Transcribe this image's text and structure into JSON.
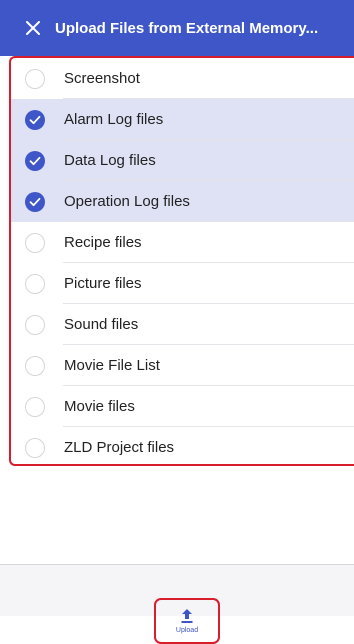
{
  "header": {
    "close_icon": "close-icon",
    "title": "Upload Files from External Memory..."
  },
  "colors": {
    "accent": "#3f56c8",
    "selected_row": "#dfe2f5",
    "highlight_outline": "#d81e2c"
  },
  "file_types": [
    {
      "label": "Screenshot",
      "selected": false
    },
    {
      "label": "Alarm Log files",
      "selected": true
    },
    {
      "label": "Data Log files",
      "selected": true
    },
    {
      "label": "Operation Log files",
      "selected": true
    },
    {
      "label": "Recipe files",
      "selected": false
    },
    {
      "label": "Picture files",
      "selected": false
    },
    {
      "label": "Sound files",
      "selected": false
    },
    {
      "label": "Movie File List",
      "selected": false
    },
    {
      "label": "Movie files",
      "selected": false
    },
    {
      "label": "ZLD Project files",
      "selected": false
    }
  ],
  "toolbar": {
    "upload_icon": "upload-icon",
    "upload_label": "Upload"
  }
}
